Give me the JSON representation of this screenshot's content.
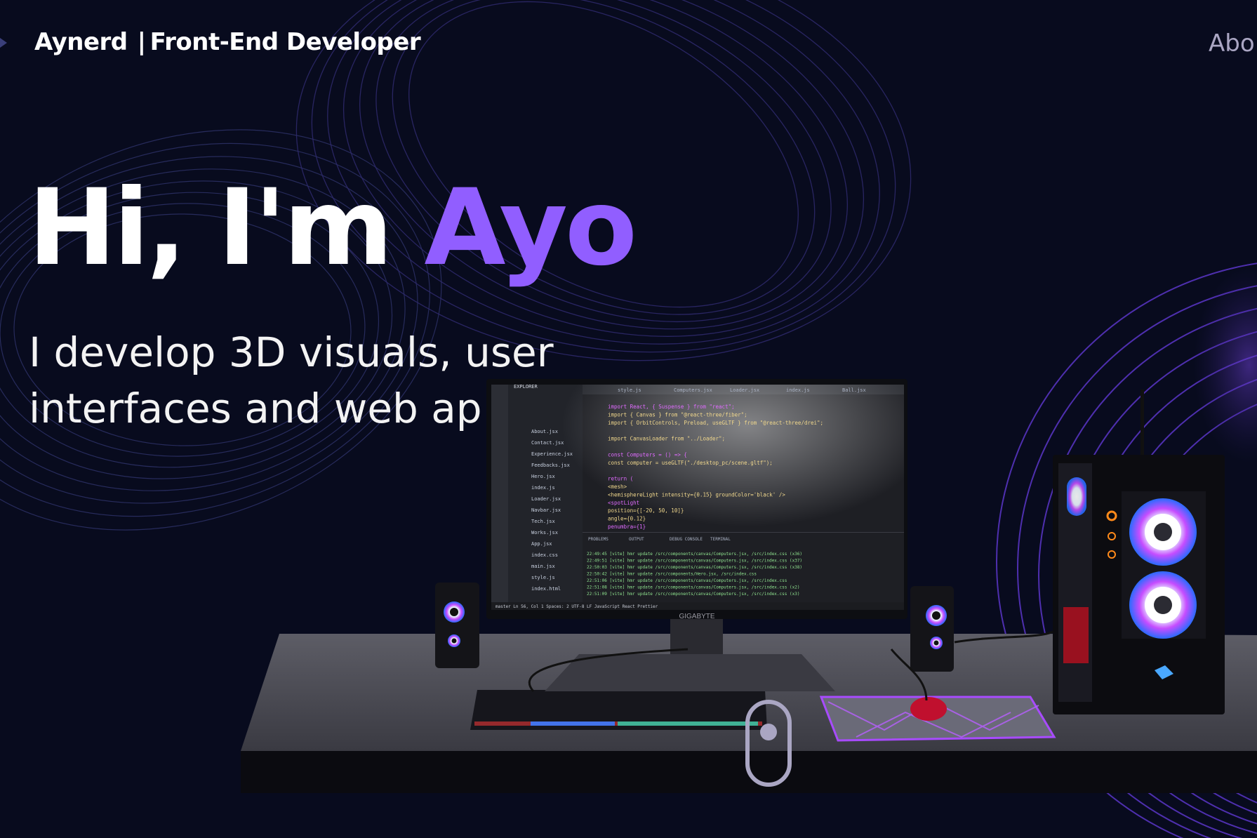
{
  "navbar": {
    "brand_name": "Aynerd",
    "brand_separator": "|",
    "brand_role": "Front-End Developer",
    "nav_link": "Abo"
  },
  "hero": {
    "greeting": "Hi, I'm ",
    "name": "Ayo",
    "subtitle_line1": "I develop 3D visuals, user",
    "subtitle_line2": "interfaces and web ap"
  },
  "colors": {
    "background": "#080b1e",
    "accent": "#915eff",
    "text": "#ffffff",
    "secondary": "#aaa6c3"
  },
  "monitor": {
    "brand": "GIGABYTE",
    "editor_tabs": [
      "style.js",
      "Computers.jsx",
      "Loader.jsx",
      "index.js",
      "Ball.jsx"
    ],
    "explorer_title": "EXPLORER",
    "file_list": [
      "About.jsx",
      "Contact.jsx",
      "Experience.jsx",
      "Feedbacks.jsx",
      "Hero.jsx",
      "index.js",
      "Loader.jsx",
      "Navbar.jsx",
      "Tech.jsx",
      "Works.jsx",
      "App.jsx",
      "index.css",
      "main.jsx",
      "style.js",
      "index.html"
    ],
    "panel_tabs": [
      "PROBLEMS",
      "OUTPUT",
      "DEBUG CONSOLE",
      "TERMINAL"
    ],
    "code_lines": [
      "import React, { Suspense } from \"react\";",
      "import { Canvas } from \"@react-three/fiber\";",
      "import { OrbitControls, Preload, useGLTF } from \"@react-three/drei\";",
      "",
      "import CanvasLoader from \"../Loader\";",
      "",
      "const Computers = () => {",
      "  const computer = useGLTF(\"./desktop_pc/scene.gltf\");",
      "",
      "  return (",
      "    <mesh>",
      "      <hemisphereLight intensity={0.15} groundColor='black' />",
      "      <spotLight",
      "        position={[-20, 50, 10]}",
      "        angle={0.12}",
      "        penumbra={1}"
    ],
    "terminal_lines": [
      "22:49:45 [vite] hmr update /src/components/canvas/Computers.jsx, /src/index.css (x36)",
      "22:49:51 [vite] hmr update /src/components/canvas/Computers.jsx, /src/index.css (x37)",
      "22:50:03 [vite] hmr update /src/components/canvas/Computers.jsx, /src/index.css (x38)",
      "22:50:42 [vite] hmr update /src/components/Hero.jsx, /src/index.css",
      "22:51:06 [vite] hmr update /src/components/canvas/Computers.jsx, /src/index.css",
      "22:51:08 [vite] hmr update /src/components/canvas/Computers.jsx, /src/index.css (x2)",
      "22:51:09 [vite] hmr update /src/components/canvas/Computers.jsx, /src/index.css (x3)"
    ],
    "status_bar": "master    Ln 56, Col 1   Spaces: 2   UTF-8   LF   JavaScript React   Prettier"
  }
}
